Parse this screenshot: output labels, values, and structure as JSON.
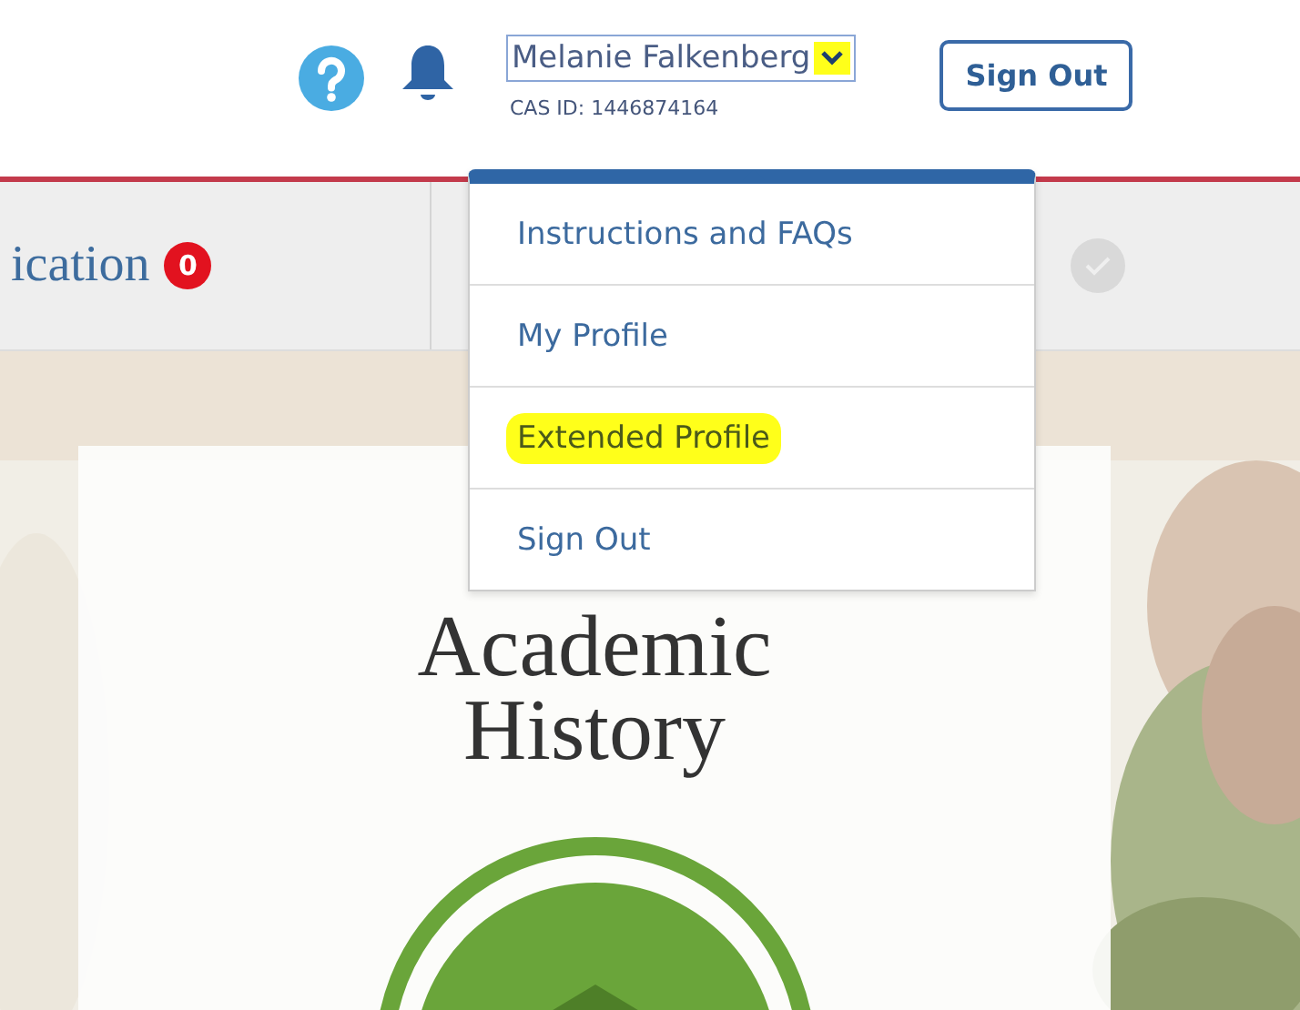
{
  "header": {
    "user_name": "Melanie Falkenberg",
    "chevron_highlighted": true,
    "cas_id": "CAS ID: 1446874164",
    "sign_out": "Sign Out"
  },
  "tabs": [
    {
      "label": "ication",
      "badge": "0"
    }
  ],
  "step_status": {
    "completed": false
  },
  "user_menu": {
    "items": [
      {
        "label": "Instructions and FAQs",
        "highlighted": false
      },
      {
        "label": "My Profile",
        "highlighted": false
      },
      {
        "label": "Extended Profile",
        "highlighted": true
      },
      {
        "label": "Sign Out",
        "highlighted": false
      }
    ]
  },
  "card": {
    "title_line_1": "Academic",
    "title_line_2": "History"
  }
}
